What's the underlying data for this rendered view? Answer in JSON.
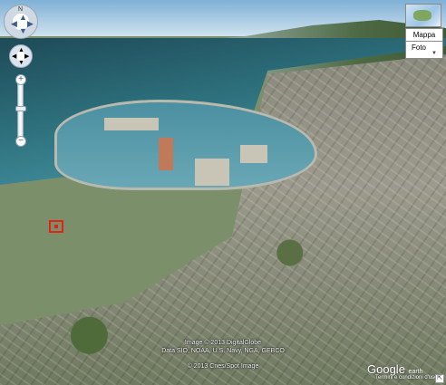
{
  "map_type": {
    "map_label": "Mappa",
    "photo_label": "Foto",
    "thumbnail_icon": "world-map-thumbnail-icon",
    "dropdown_icon": "chevron-down-icon"
  },
  "navigation": {
    "compass_north": "N",
    "zoom_in": "+",
    "zoom_out": "−",
    "compass_icon": "compass-icon",
    "pan_icon": "pan-arrows-icon"
  },
  "attribution": {
    "line1": "Image © 2013 DigitalGlobe",
    "line2": "Data SIO, NOAA, U.S. Navy, NGA, GEBCO",
    "line3": "© 2013 Cnes/Spot Image"
  },
  "logo": {
    "text": "Google",
    "suffix": "earth",
    "terms": "Termini e condizioni d'uso"
  },
  "placemark_icon": "red-placemark-icon",
  "corner_icon": "corner-resize-icon",
  "colors": {
    "placemark": "#e2231a",
    "control_accent": "#3a5f88"
  }
}
